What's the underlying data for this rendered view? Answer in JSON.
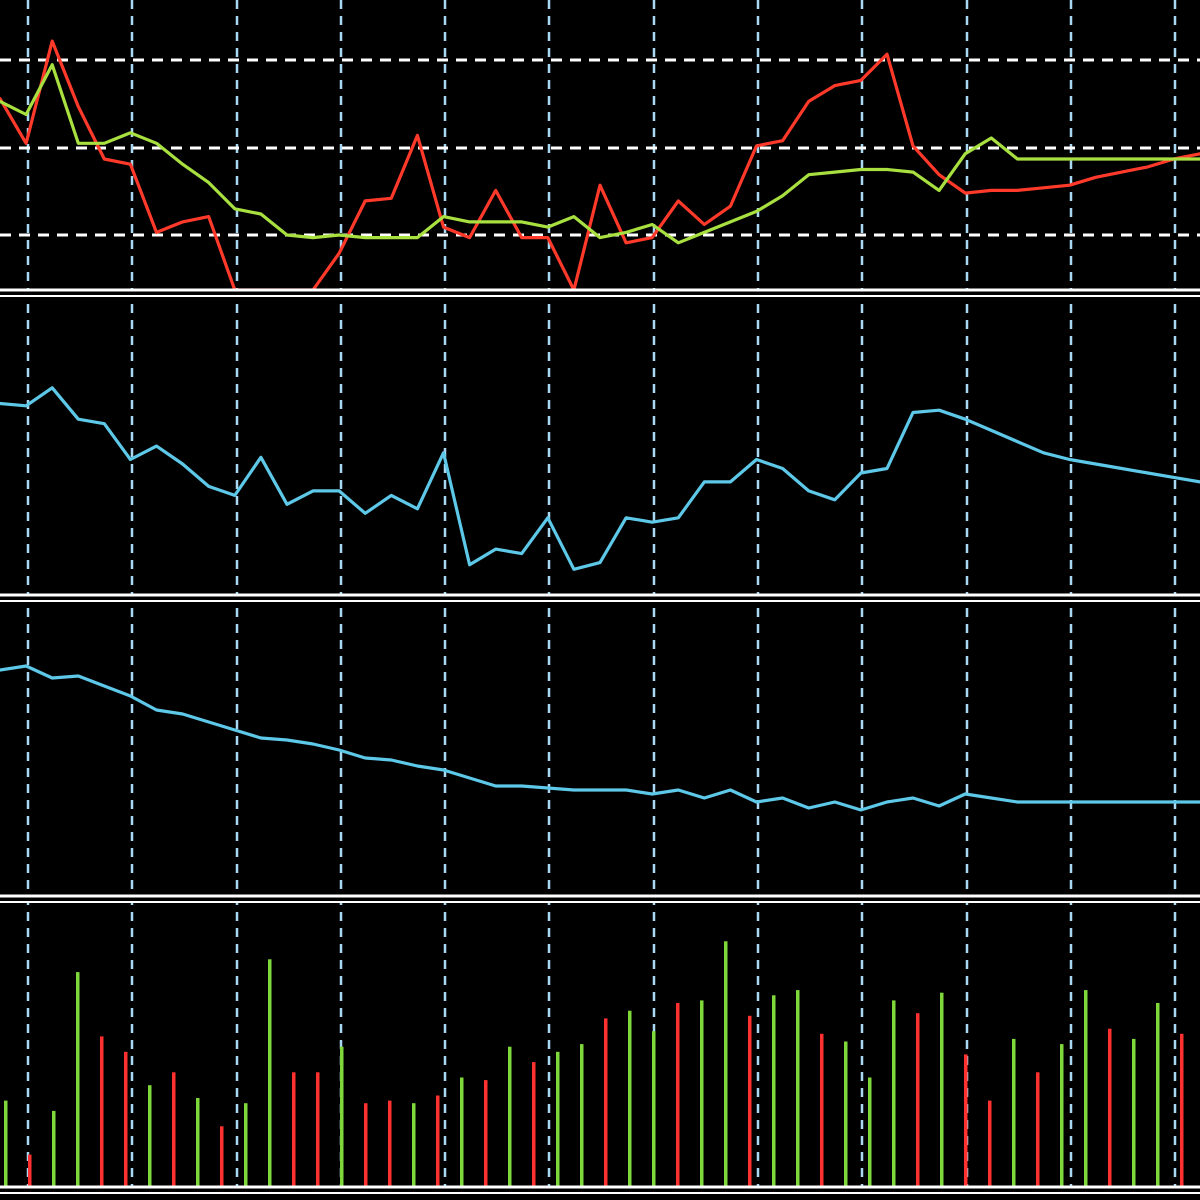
{
  "theme": {
    "background": "#000000",
    "grid_color": "#ffffff",
    "vgrid_color": "#a9d8f2",
    "separator_color": "#ffffff",
    "red": "#ff3a2a",
    "green": "#a8e040",
    "cyan": "#5ec8e8",
    "volume_green": "#7ed83a",
    "volume_red": "#ff3030"
  },
  "chart_data": [
    {
      "type": "line",
      "name": "price-oscillator-panel",
      "x": [
        0,
        1,
        2,
        3,
        4,
        5,
        6,
        7,
        8,
        9,
        10,
        11,
        12,
        13,
        14,
        15,
        16,
        17,
        18,
        19,
        20,
        21,
        22,
        23,
        24,
        25,
        26,
        27,
        28,
        29,
        30,
        31,
        32,
        33,
        34,
        35,
        36,
        37,
        38,
        39,
        40,
        41,
        42,
        43,
        44,
        45,
        46
      ],
      "ylim": [
        0,
        100
      ],
      "grid": true,
      "series": [
        {
          "color": "#ff3a2a",
          "values": [
            73,
            56,
            95,
            70,
            50,
            48,
            22,
            26,
            28,
            0,
            0,
            0,
            0,
            14,
            34,
            35,
            59,
            24,
            20,
            38,
            20,
            20,
            0,
            40,
            18,
            20,
            34,
            25,
            32,
            55,
            57,
            72,
            78,
            80,
            90,
            55,
            44,
            37,
            38,
            38,
            39,
            40,
            43,
            45,
            47,
            50,
            52
          ]
        },
        {
          "color": "#a8e040",
          "values": [
            72,
            67,
            86,
            56,
            56,
            60,
            56,
            48,
            41,
            31,
            29,
            21,
            20,
            21,
            20,
            20,
            20,
            28,
            26,
            26,
            26,
            24,
            28,
            20,
            22,
            25,
            18,
            22,
            26,
            30,
            36,
            44,
            45,
            46,
            46,
            45,
            38,
            52,
            58,
            50,
            50,
            50,
            50,
            50,
            50,
            50,
            50
          ]
        }
      ]
    },
    {
      "type": "line",
      "name": "momentum-panel",
      "x": [
        0,
        1,
        2,
        3,
        4,
        5,
        6,
        7,
        8,
        9,
        10,
        11,
        12,
        13,
        14,
        15,
        16,
        17,
        18,
        19,
        20,
        21,
        22,
        23,
        24,
        25,
        26,
        27,
        28,
        29,
        30,
        31,
        32,
        33,
        34,
        35,
        36,
        37,
        38,
        39,
        40,
        41,
        42,
        43,
        44,
        45,
        46
      ],
      "ylim": [
        0,
        100
      ],
      "grid": false,
      "series": [
        {
          "color": "#5ec8e8",
          "values": [
            77,
            76,
            84,
            70,
            68,
            52,
            58,
            50,
            40,
            36,
            53,
            32,
            38,
            38,
            28,
            36,
            30,
            55,
            5,
            12,
            10,
            26,
            3,
            6,
            26,
            24,
            26,
            42,
            42,
            52,
            48,
            38,
            34,
            46,
            48,
            73,
            74,
            70,
            65,
            60,
            55,
            52,
            50,
            48,
            46,
            44,
            42
          ]
        }
      ]
    },
    {
      "type": "line",
      "name": "trend-panel",
      "x": [
        0,
        1,
        2,
        3,
        4,
        5,
        6,
        7,
        8,
        9,
        10,
        11,
        12,
        13,
        14,
        15,
        16,
        17,
        18,
        19,
        20,
        21,
        22,
        23,
        24,
        25,
        26,
        27,
        28,
        29,
        30,
        31,
        32,
        33,
        34,
        35,
        36,
        37,
        38,
        39,
        40,
        41,
        42,
        43,
        44,
        45,
        46
      ],
      "ylim": [
        0,
        100
      ],
      "grid": false,
      "series": [
        {
          "color": "#5ec8e8",
          "values": [
            78,
            80,
            74,
            75,
            70,
            65,
            58,
            56,
            52,
            48,
            44,
            43,
            41,
            38,
            34,
            33,
            30,
            28,
            24,
            20,
            20,
            19,
            18,
            18,
            18,
            16,
            18,
            14,
            18,
            12,
            14,
            9,
            12,
            8,
            12,
            14,
            10,
            16,
            14,
            12,
            12,
            12,
            12,
            12,
            12,
            12,
            12
          ]
        }
      ]
    },
    {
      "type": "bar",
      "name": "volume-panel",
      "x": [
        0,
        1,
        2,
        3,
        4,
        5,
        6,
        7,
        8,
        9,
        10,
        11,
        12,
        13,
        14,
        15,
        16,
        17,
        18,
        19,
        20,
        21,
        22,
        23,
        24,
        25,
        26,
        27,
        28,
        29,
        30,
        31,
        32,
        33,
        34,
        35,
        36,
        37,
        38,
        39,
        40,
        41,
        42,
        43,
        44,
        45,
        46
      ],
      "ylim": [
        0,
        100
      ],
      "values": [
        34,
        13,
        30,
        84,
        59,
        53,
        40,
        45,
        35,
        24,
        33,
        89,
        45,
        45,
        55,
        33,
        34,
        33,
        36,
        43,
        42,
        55,
        49,
        53,
        56,
        66,
        69,
        61,
        72,
        73,
        96,
        67,
        75,
        77,
        60,
        57,
        43,
        73,
        68,
        76,
        52,
        34,
        58,
        45,
        56,
        77,
        62,
        58,
        72,
        60
      ],
      "colors": [
        "green",
        "red",
        "green",
        "green",
        "red",
        "red",
        "green",
        "red",
        "green",
        "red",
        "green",
        "green",
        "red",
        "red",
        "green",
        "red",
        "red",
        "green",
        "red",
        "green",
        "red",
        "green",
        "red",
        "green",
        "green",
        "red",
        "green",
        "green",
        "red",
        "green",
        "green",
        "red",
        "green",
        "green",
        "red",
        "green",
        "green",
        "green",
        "red",
        "green",
        "red",
        "red",
        "green",
        "red",
        "green",
        "green",
        "red",
        "green",
        "green",
        "red"
      ]
    }
  ]
}
